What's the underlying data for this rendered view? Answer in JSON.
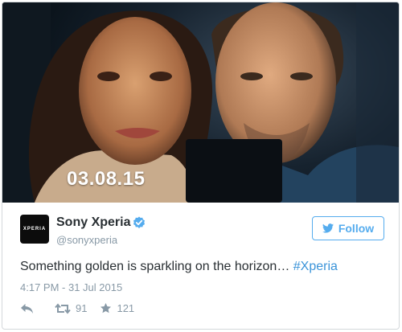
{
  "photo": {
    "date_overlay": "03.08.15"
  },
  "account": {
    "avatar_text": "XPERIA",
    "name": "Sony Xperia",
    "handle": "@sonyxperia",
    "verified": true
  },
  "follow_button": {
    "label": "Follow"
  },
  "tweet": {
    "text": "Something golden is sparkling on the horizon… ",
    "hashtag": "#Xperia",
    "timestamp": "4:17 PM - 31 Jul 2015"
  },
  "actions": {
    "retweets": "91",
    "likes": "121"
  },
  "colors": {
    "accent": "#55acee",
    "hashtag": "#3b94d9",
    "muted": "#8899a6",
    "text": "#292f33"
  },
  "icons": [
    "verified-badge-icon",
    "twitter-bird-icon",
    "reply-icon",
    "retweet-icon",
    "favorite-star-icon"
  ]
}
